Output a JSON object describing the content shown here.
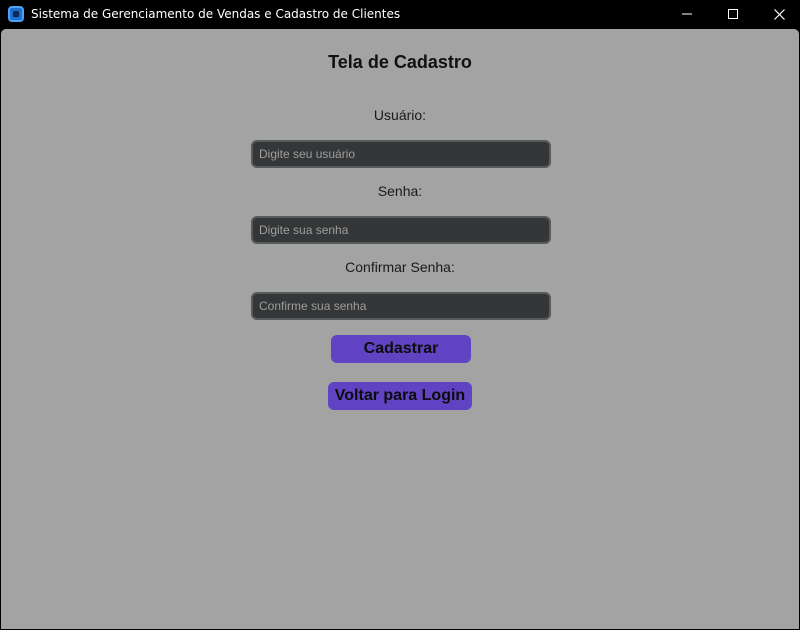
{
  "window": {
    "title": "Sistema de Gerenciamento de Vendas e Cadastro de Clientes",
    "controls": {
      "minimize_icon": "minimize-icon",
      "maximize_icon": "maximize-icon",
      "close_icon": "close-icon"
    }
  },
  "form": {
    "heading": "Tela de Cadastro",
    "username": {
      "label": "Usuário:",
      "value": "",
      "placeholder": "Digite seu usuário"
    },
    "password": {
      "label": "Senha:",
      "value": "",
      "placeholder": "Digite sua senha"
    },
    "confirm_password": {
      "label": "Confirmar Senha:",
      "value": "",
      "placeholder": "Confirme sua senha"
    },
    "register_button": "Cadastrar",
    "back_button": "Voltar para Login"
  },
  "colors": {
    "background": "#a3a3a3",
    "titlebar": "#000000",
    "input_background": "#343638",
    "input_border": "#565b5e",
    "button_accent": "#5f43c2"
  }
}
